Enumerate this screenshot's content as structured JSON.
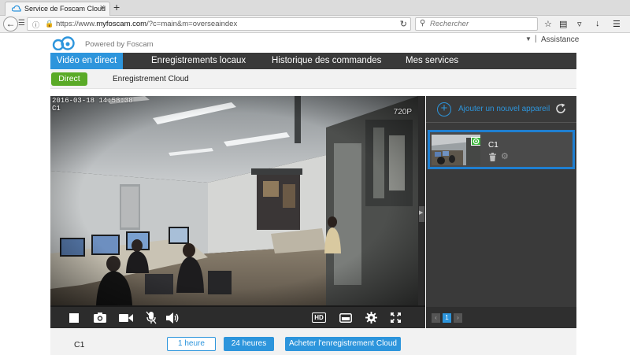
{
  "browser": {
    "tab_title": "Service de Foscam Cloud",
    "tab_close": "×",
    "new_tab": "+",
    "url_prefix": "https://www.",
    "url_host": "myfoscam.com",
    "url_path": "/?c=main&m=overseaindex",
    "search_placeholder": "Rechercher"
  },
  "header": {
    "powered_by": "Powered by Foscam",
    "separator": "|",
    "assistance": "Assistance"
  },
  "nav": {
    "items": [
      {
        "label": "Vidéo en direct"
      },
      {
        "label": "Enregistrements locaux"
      },
      {
        "label": "Historique des commandes"
      },
      {
        "label": "Mes services"
      }
    ]
  },
  "subnav": {
    "direct": "Direct",
    "cloud": "Enregistrement Cloud"
  },
  "video": {
    "timestamp": "2016-03-18  14:58:38",
    "camera_label": "C1",
    "resolution": "720P",
    "controls": [
      {
        "icon": "stop-icon"
      },
      {
        "icon": "snapshot-camera-icon"
      },
      {
        "icon": "record-video-icon"
      },
      {
        "icon": "microphone-muted-icon"
      },
      {
        "icon": "speaker-icon"
      },
      {
        "icon": "hd-icon",
        "label": "HD"
      },
      {
        "icon": "aspect-ratio-icon"
      },
      {
        "icon": "settings-gear-icon"
      },
      {
        "icon": "fullscreen-icon"
      }
    ]
  },
  "devices": {
    "add_label": "Ajouter un nouvel appareil",
    "list": [
      {
        "name": "C1",
        "status": "online"
      }
    ],
    "pager": {
      "prev": "‹",
      "current": "1",
      "next": "›"
    }
  },
  "bottom": {
    "camera": "C1",
    "btn_1h": "1 heure",
    "btn_24h": "24 heures",
    "btn_buy": "Acheter l'enregistrement Cloud"
  },
  "colors": {
    "accent": "#2d95dc",
    "nav_bg": "#3a3a3a",
    "direct_green": "#5aaa27",
    "online_green": "#3fb73f",
    "selected_border": "#1f7fd1"
  }
}
